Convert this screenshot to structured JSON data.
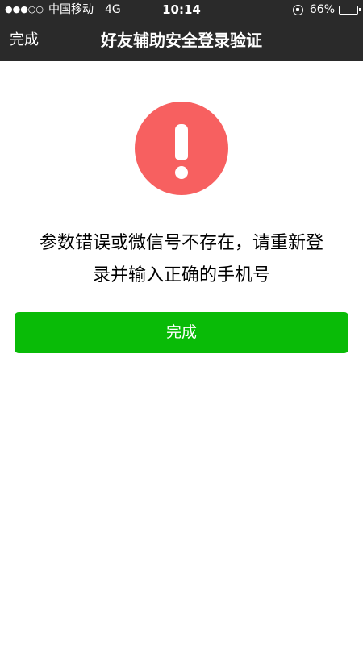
{
  "status_bar": {
    "signal_dots": "●●●○○",
    "carrier": "中国移动",
    "network": "4G",
    "time": "10:14",
    "battery_percent": "66%",
    "battery_level": 0.66,
    "icons": [
      "signal-icon",
      "orientation-lock-icon",
      "battery-icon"
    ]
  },
  "nav": {
    "back_label": "完成",
    "title": "好友辅助安全登录验证"
  },
  "alert": {
    "icon": "exclamation-icon",
    "color": "#f76060"
  },
  "message": {
    "line1": "参数错误或微信号不存在，请重新登",
    "line2": "录并输入正确的手机号"
  },
  "button": {
    "label": "完成",
    "color": "#09bb07"
  }
}
